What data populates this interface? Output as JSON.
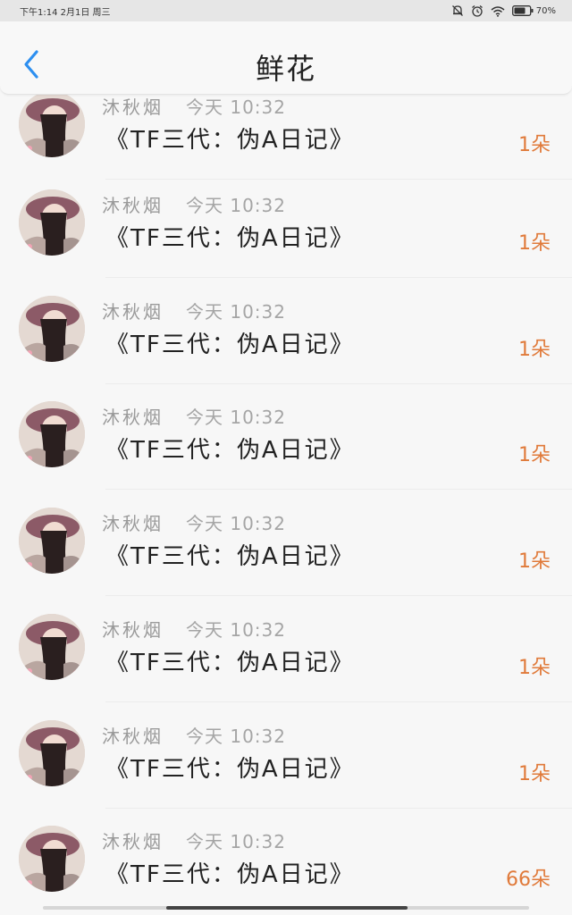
{
  "status_bar": {
    "time_date": "下午1:14 2月1日 周三",
    "battery": "70%",
    "icons": [
      "mute-bell-icon",
      "alarm-icon",
      "wifi-icon",
      "battery-icon"
    ]
  },
  "header": {
    "title": "鲜花",
    "back_icon": "chevron-left-icon"
  },
  "colors": {
    "accent": "#2d8ff0",
    "count": "#e07a3a"
  },
  "items": [
    {
      "name": "沐秋烟",
      "time": "今天 10:32",
      "title": "《TF三代：伪A日记》",
      "count": "1朵"
    },
    {
      "name": "沐秋烟",
      "time": "今天 10:32",
      "title": "《TF三代：伪A日记》",
      "count": "1朵"
    },
    {
      "name": "沐秋烟",
      "time": "今天 10:32",
      "title": "《TF三代：伪A日记》",
      "count": "1朵"
    },
    {
      "name": "沐秋烟",
      "time": "今天 10:32",
      "title": "《TF三代：伪A日记》",
      "count": "1朵"
    },
    {
      "name": "沐秋烟",
      "time": "今天 10:32",
      "title": "《TF三代：伪A日记》",
      "count": "1朵"
    },
    {
      "name": "沐秋烟",
      "time": "今天 10:32",
      "title": "《TF三代：伪A日记》",
      "count": "1朵"
    },
    {
      "name": "沐秋烟",
      "time": "今天 10:32",
      "title": "《TF三代：伪A日记》",
      "count": "1朵"
    },
    {
      "name": "沐秋烟",
      "time": "今天 10:32",
      "title": "《TF三代：伪A日记》",
      "count": "66朵"
    }
  ]
}
